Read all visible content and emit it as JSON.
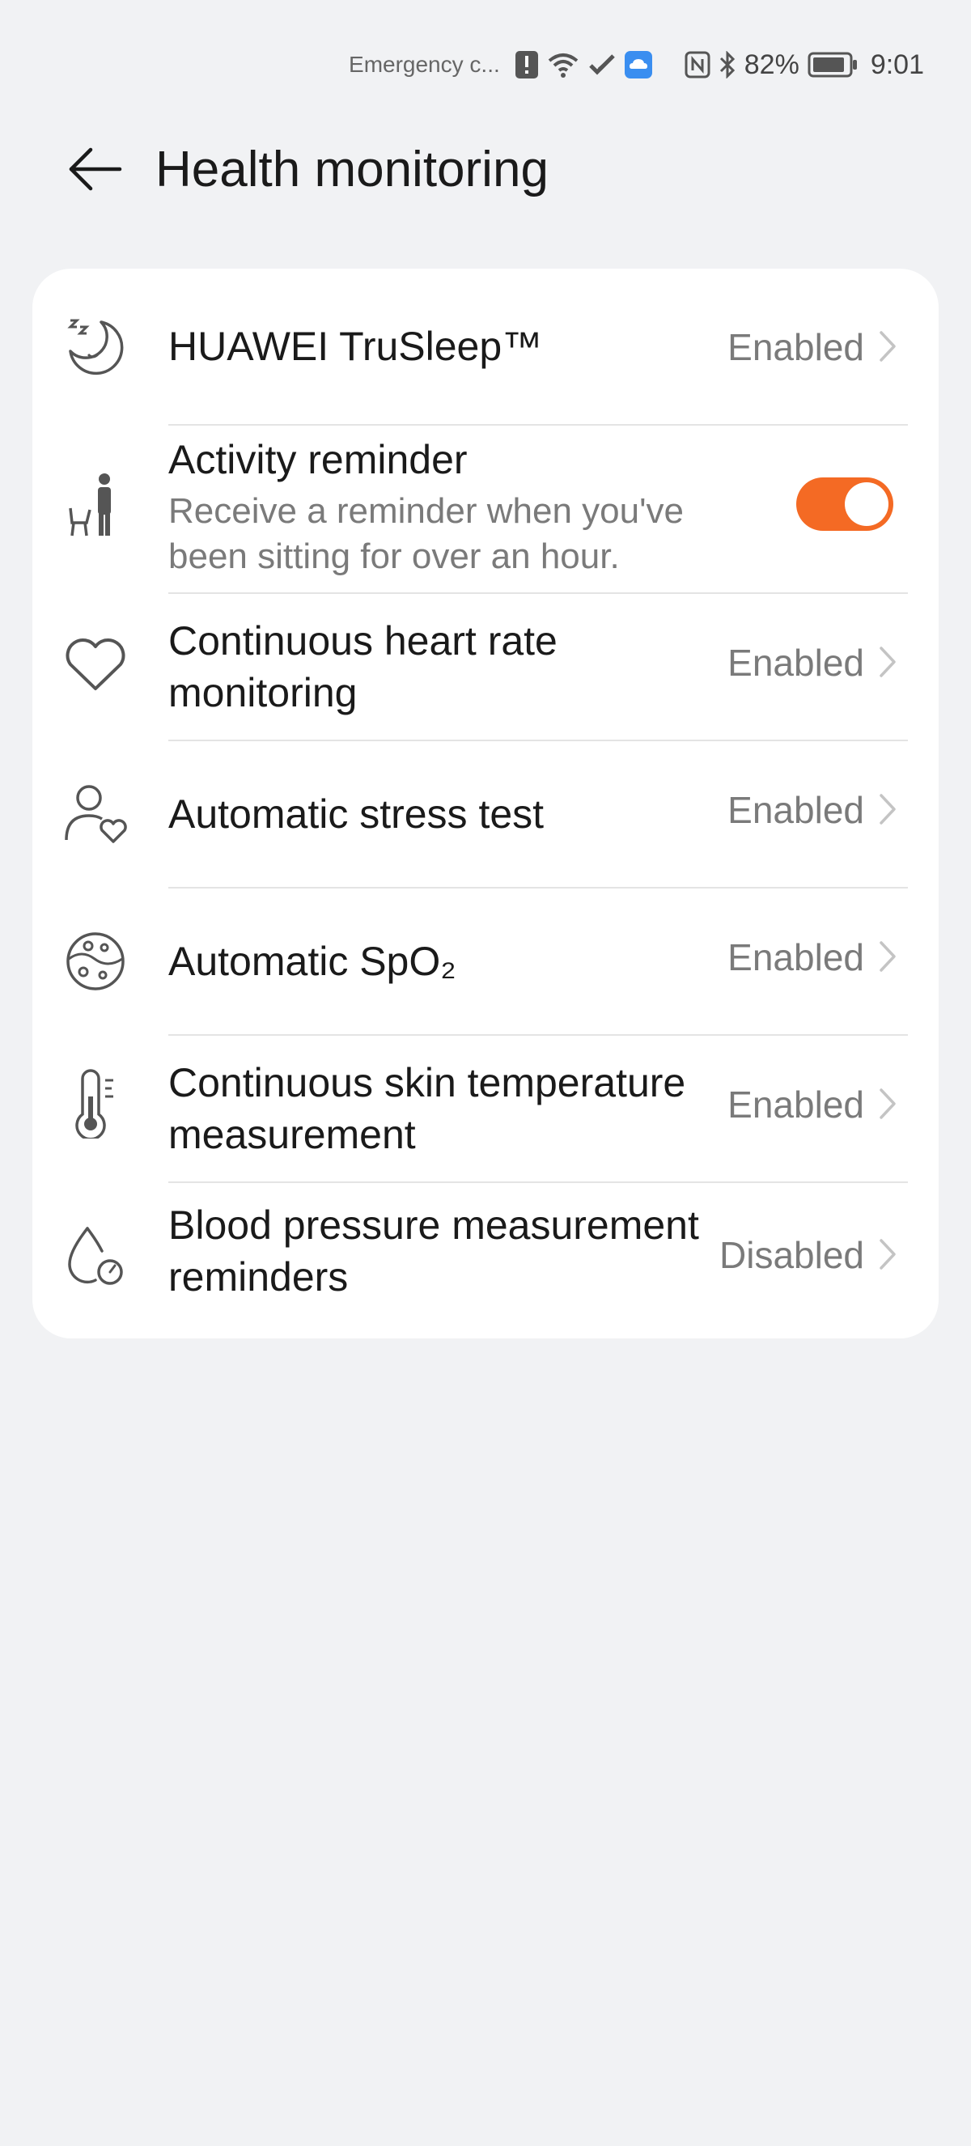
{
  "status_bar": {
    "carrier": "Emergency c...",
    "battery": "82%",
    "time": "9:01",
    "icons": [
      "alert-icon",
      "wifi-icon",
      "hotspot-icon",
      "cloud-icon",
      "nfc-icon",
      "bluetooth-icon",
      "battery-icon"
    ]
  },
  "header": {
    "title": "Health monitoring",
    "back_icon": "back-arrow-icon"
  },
  "settings": [
    {
      "id": "trusleep",
      "icon": "sleep-icon",
      "title": "HUAWEI TruSleep™",
      "status": "Enabled"
    },
    {
      "id": "activity",
      "icon": "sitting-person-icon",
      "title": "Activity reminder",
      "subtitle": "Receive a reminder when you've been sitting for over an hour.",
      "toggle_on": true
    },
    {
      "id": "heart",
      "icon": "heart-icon",
      "title": "Continuous heart rate monitoring",
      "status": "Enabled"
    },
    {
      "id": "stress",
      "icon": "stress-person-icon",
      "title": "Automatic stress test",
      "status": "Enabled"
    },
    {
      "id": "spo2",
      "icon": "spo2-icon",
      "title": "Automatic SpO₂",
      "status": "Enabled"
    },
    {
      "id": "skin",
      "icon": "thermometer-icon",
      "title": "Continuous skin temperature measurement",
      "status": "Enabled"
    },
    {
      "id": "bp",
      "icon": "blood-pressure-icon",
      "title": "Blood pressure measurement reminders",
      "status": "Disabled"
    }
  ],
  "colors": {
    "accent": "#f46a24",
    "background": "#f1f2f4",
    "card": "#ffffff",
    "secondary_text": "#7a7a7a"
  }
}
